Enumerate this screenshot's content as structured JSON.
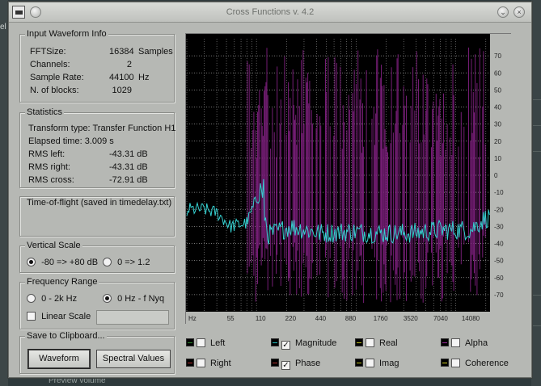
{
  "window": {
    "title": "Cross Functions v. 4.2"
  },
  "background": {
    "left_text": "el",
    "bottom_text": "Preview volume"
  },
  "input_info": {
    "title": "Input Waveform Info",
    "rows": [
      {
        "label": "FFTSize:",
        "value": "16384",
        "unit": "Samples"
      },
      {
        "label": "Channels:",
        "value": "2",
        "unit": ""
      },
      {
        "label": "Sample Rate:",
        "value": "44100",
        "unit": "Hz"
      },
      {
        "label": "N. of blocks:",
        "value": "1029",
        "unit": ""
      }
    ]
  },
  "statistics": {
    "title": "Statistics",
    "transform": "Transform type: Transfer Function H1",
    "elapsed": "Elapsed time: 3.009 s",
    "rows": [
      {
        "label": "RMS left:",
        "value": "-43.31 dB"
      },
      {
        "label": "RMS right:",
        "value": "-43.31 dB"
      },
      {
        "label": "RMS cross:",
        "value": "-72.91 dB"
      }
    ]
  },
  "tof": {
    "title": "Time-of-flight (saved in timedelay.txt)"
  },
  "vertical_scale": {
    "title": "Vertical Scale",
    "opt1": "-80 => +80 dB",
    "opt2": "0 => 1.2",
    "selected": 1
  },
  "frequency_range": {
    "title": "Frequency Range",
    "opt1": "0 - 2k Hz",
    "opt2": "0 Hz - f Nyq",
    "selected": 2,
    "linear_label": "Linear Scale"
  },
  "clipboard": {
    "title": "Save to Clipboard...",
    "waveform": "Waveform",
    "spectral": "Spectral Values"
  },
  "legend": [
    {
      "label": "Left",
      "checked": false,
      "color": "#2e8b2e"
    },
    {
      "label": "Right",
      "checked": false,
      "color": "#b03030"
    },
    {
      "label": "Magnitude",
      "checked": true,
      "color": "#20c0c0"
    },
    {
      "label": "Phase",
      "checked": true,
      "color": "#b03030"
    },
    {
      "label": "Real",
      "checked": false,
      "color": "#c0c020"
    },
    {
      "label": "Imag",
      "checked": false,
      "color": "#c0c020"
    },
    {
      "label": "Alpha",
      "checked": false,
      "color": "#9a2a9a"
    },
    {
      "label": "Coherence",
      "checked": false,
      "color": "#d0d020"
    }
  ],
  "chart_data": {
    "type": "line",
    "x_scale": "log",
    "xlabel": "Hz",
    "x_ticks": [
      "55",
      "110",
      "220",
      "440",
      "880",
      "1760",
      "3520",
      "7040",
      "14080"
    ],
    "y_ticks": [
      "70",
      "60",
      "50",
      "40",
      "30",
      "20",
      "10",
      "0",
      "-10",
      "-20",
      "-30",
      "-40",
      "-50",
      "-60",
      "-70"
    ],
    "ylim": [
      -80,
      80
    ],
    "grid": true,
    "colors": {
      "magnitude": "#35d0d0",
      "phase": "#7a1f7a",
      "grid": "#9a9a9a"
    },
    "series": [
      {
        "name": "Magnitude",
        "note": "noisy trace around -30 dB with spikes near low frequencies",
        "approx": [
          [
            20,
            -20
          ],
          [
            30,
            -20
          ],
          [
            40,
            -22
          ],
          [
            55,
            -30
          ],
          [
            80,
            -28
          ],
          [
            110,
            -8
          ],
          [
            130,
            -35
          ],
          [
            220,
            -30
          ],
          [
            440,
            -34
          ],
          [
            880,
            -33
          ],
          [
            1760,
            -34
          ],
          [
            3520,
            -34
          ],
          [
            7040,
            -32
          ],
          [
            14080,
            -32
          ],
          [
            20000,
            -25
          ]
        ]
      },
      {
        "name": "Phase",
        "note": "dense vertical excursions spanning roughly -80 to +70"
      }
    ]
  }
}
